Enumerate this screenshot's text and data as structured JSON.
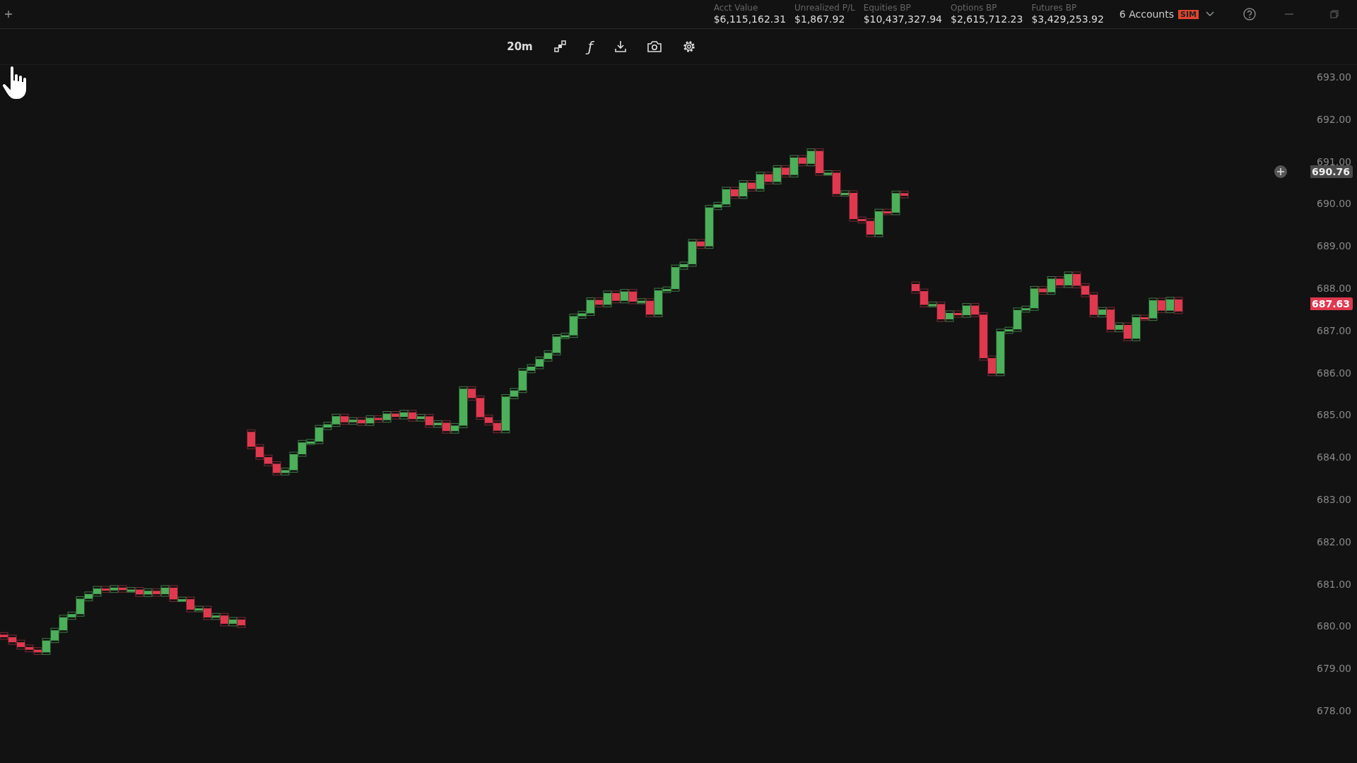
{
  "top_bar": {
    "stats": [
      {
        "label": "Acct Value",
        "value": "$6,115,162.31"
      },
      {
        "label": "Unrealized P/L",
        "value": "$1,867.92"
      },
      {
        "label": "Equities BP",
        "value": "$10,437,327.94"
      },
      {
        "label": "Options BP",
        "value": "$2,615,712.23"
      },
      {
        "label": "Futures BP",
        "value": "$3,429,253.92"
      }
    ],
    "accounts": {
      "label": "6 Accounts",
      "badge": "SIM"
    }
  },
  "toolbar": {
    "interval": "20m",
    "studies": "ƒ"
  },
  "price_axis": {
    "ticks": [
      "693.00",
      "692.00",
      "691.00",
      "690.00",
      "689.00",
      "688.00",
      "687.00",
      "686.00",
      "685.00",
      "684.00",
      "683.00",
      "682.00",
      "681.00",
      "680.00",
      "679.00",
      "678.00"
    ],
    "crosshair_price": "690.76",
    "last_price": "687.63"
  }
}
